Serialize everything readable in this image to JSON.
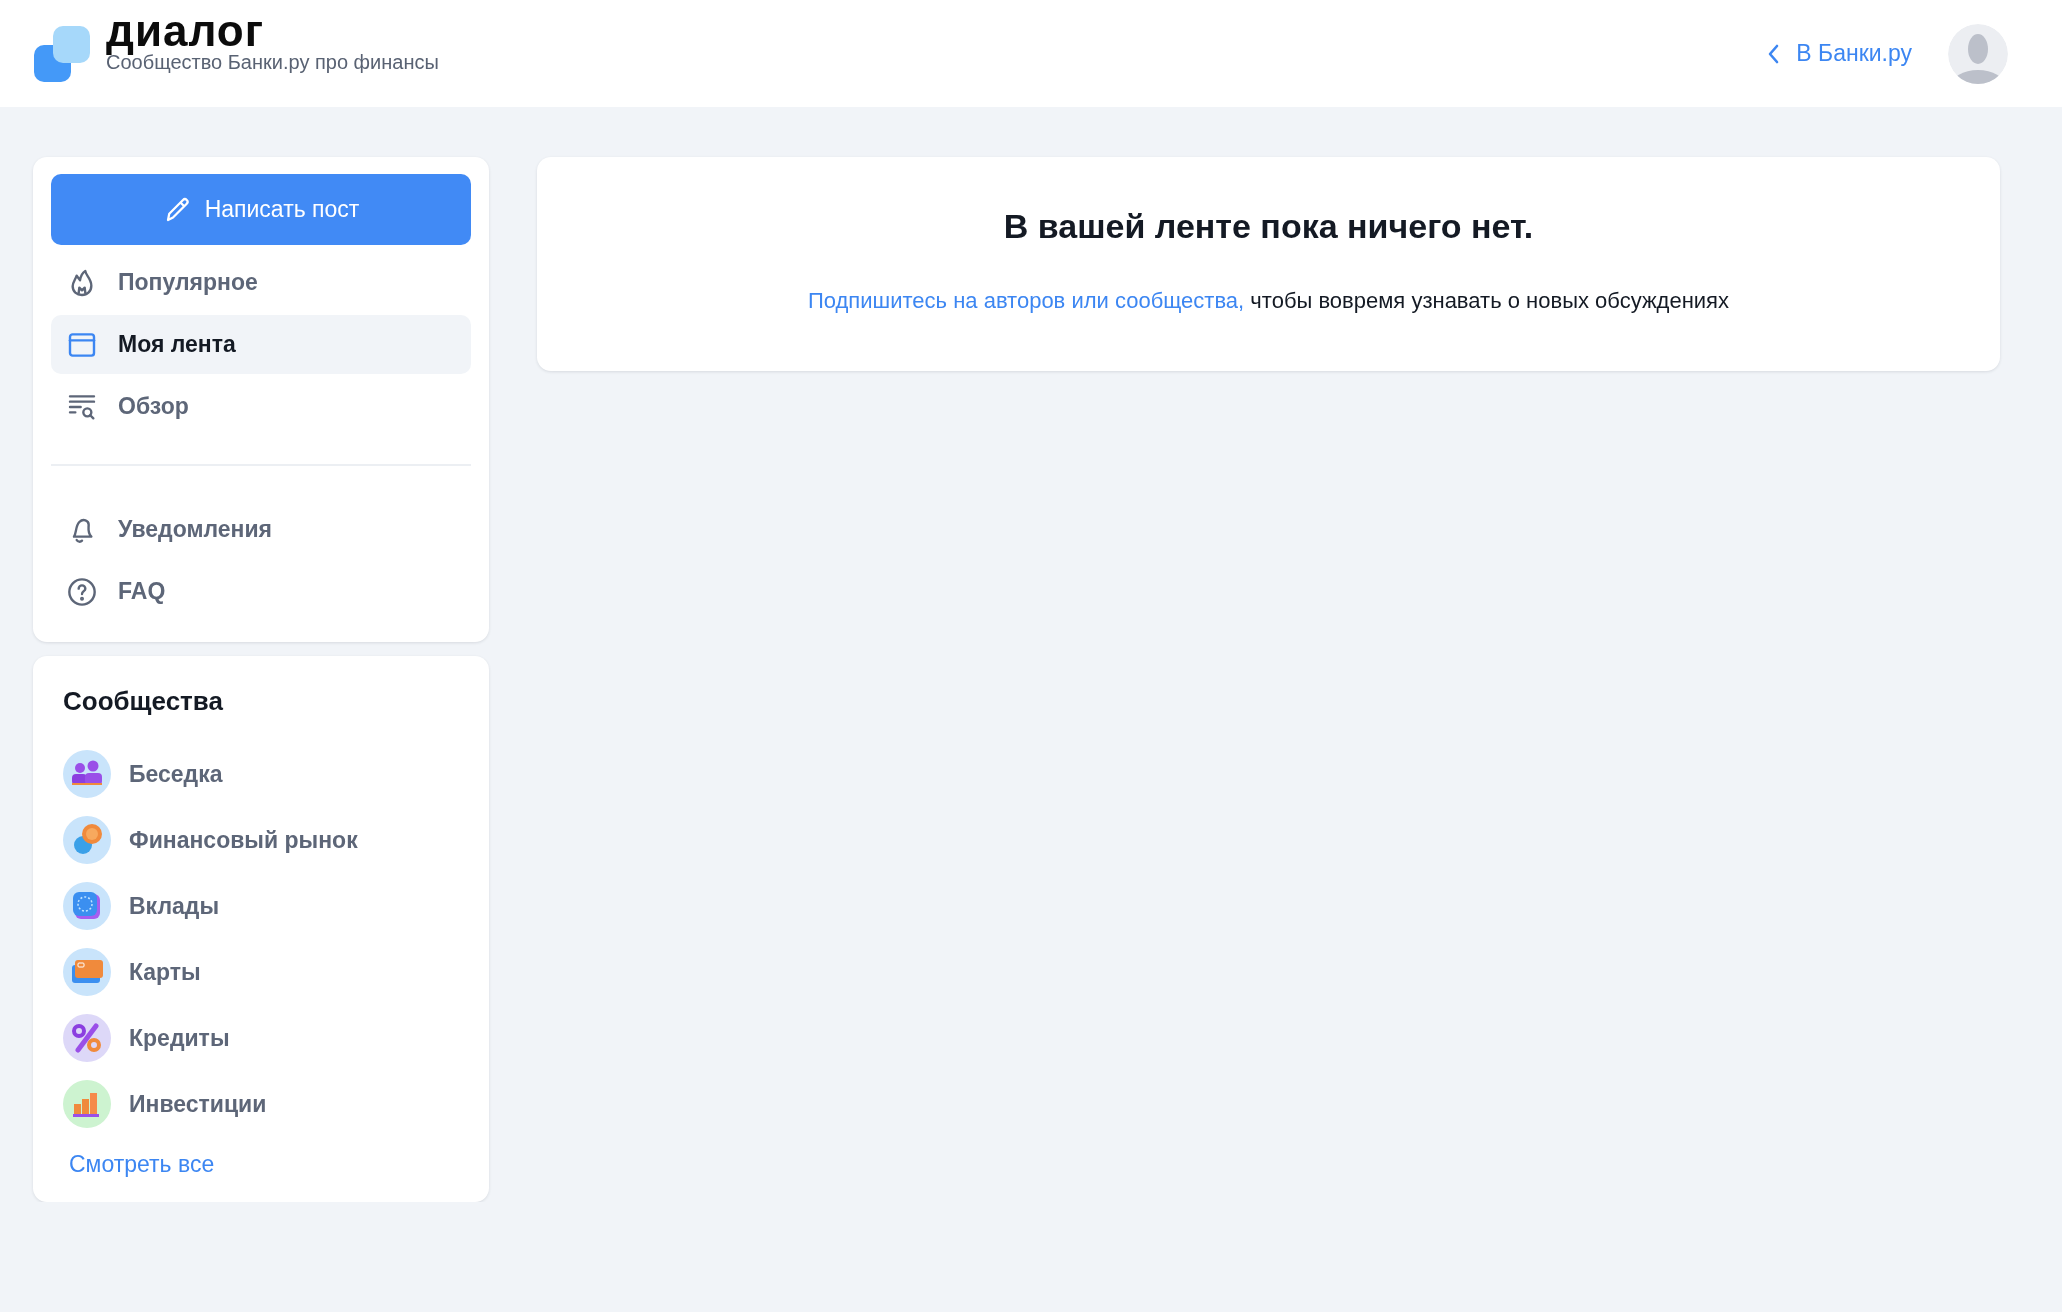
{
  "header": {
    "logo": "диалог",
    "tagline": "Сообщество Банки.ру про финансы",
    "back_link": "В Банки.ру"
  },
  "sidebar": {
    "write_button": "Написать пост",
    "nav_groups": [
      [
        {
          "kind": "flame",
          "label": "Популярное",
          "selected": false
        },
        {
          "kind": "feed",
          "label": "Моя лента",
          "selected": true
        },
        {
          "kind": "browse",
          "label": "Обзор",
          "selected": false
        }
      ],
      [
        {
          "kind": "bell",
          "label": "Уведомления",
          "selected": false
        },
        {
          "kind": "help",
          "label": "FAQ",
          "selected": false
        }
      ]
    ]
  },
  "communities": {
    "title": "Сообщества",
    "items": [
      {
        "kind": "people",
        "label": "Беседка"
      },
      {
        "kind": "coins",
        "label": "Финансовый рынок"
      },
      {
        "kind": "deposit",
        "label": "Вклады"
      },
      {
        "kind": "card",
        "label": "Карты"
      },
      {
        "kind": "percent",
        "label": "Кредиты"
      },
      {
        "kind": "chart",
        "label": "Инвестиции"
      }
    ],
    "see_all": "Смотреть все"
  },
  "feed": {
    "title": "В вашей ленте пока ничего нет.",
    "link": "Подпишитесь на авторов или сообщества,",
    "text": "чтобы вовремя узнавать о новых обсуждениях"
  }
}
